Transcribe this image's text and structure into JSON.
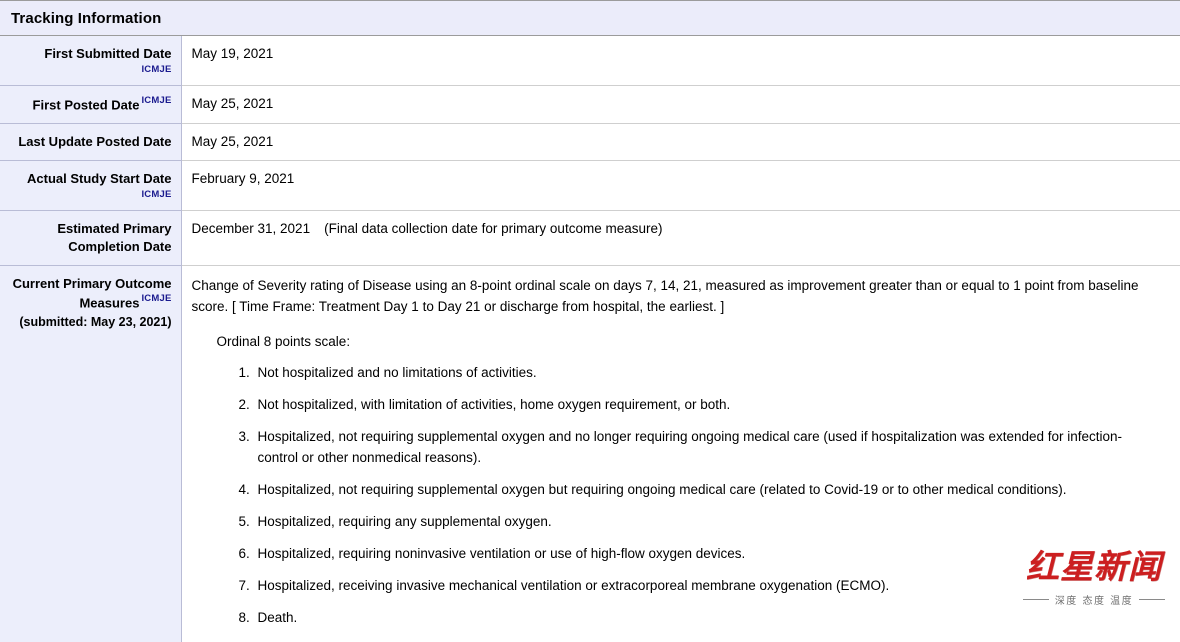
{
  "section": {
    "title": "Tracking Information"
  },
  "icmje_label": "ICMJE",
  "rows": [
    {
      "label": "First Submitted Date",
      "icmje": true,
      "icmje_placement": "below",
      "value": "May 19, 2021"
    },
    {
      "label": "First Posted Date",
      "icmje": true,
      "icmje_placement": "inline",
      "value": "May 25, 2021"
    },
    {
      "label": "Last Update Posted Date",
      "icmje": false,
      "icmje_placement": "none",
      "value": "May 25, 2021"
    },
    {
      "label": "Actual Study Start Date",
      "icmje": true,
      "icmje_placement": "below",
      "value": "February 9, 2021"
    },
    {
      "label": "Estimated Primary Completion Date",
      "icmje": false,
      "icmje_placement": "none",
      "value": "December 31, 2021",
      "value_note": "(Final data collection date for primary outcome measure)"
    }
  ],
  "outcome": {
    "label": "Current Primary Outcome Measures",
    "icmje": true,
    "submitted_note": "(submitted: May 23, 2021)",
    "intro": "Change of Severity rating of Disease using an 8-point ordinal scale on days 7, 14, 21, measured as improvement greater than or equal to 1 point from baseline score. [ Time Frame: Treatment Day 1 to Day 21 or discharge from hospital, the earliest. ]",
    "scale_heading": "Ordinal 8 points scale:",
    "scale_items": [
      "Not hospitalized and no limitations of activities.",
      "Not hospitalized, with limitation of activities, home oxygen requirement, or both.",
      "Hospitalized, not requiring supplemental oxygen and no longer requiring ongoing medical care (used if hospitalization was extended for infection-control or other nonmedical reasons).",
      "Hospitalized, not requiring supplemental oxygen but requiring ongoing medical care (related to Covid-19 or to other medical conditions).",
      "Hospitalized, requiring any supplemental oxygen.",
      "Hospitalized, requiring noninvasive ventilation or use of high-flow oxygen devices.",
      "Hospitalized, receiving invasive mechanical ventilation or extracorporeal membrane oxygenation (ECMO).",
      "Death."
    ]
  },
  "watermark": {
    "brand": "红星新闻",
    "tagline": "深度 态度 温度"
  },
  "colors": {
    "header_bg": "#ebecfa",
    "label_bg": "#eceefb",
    "link": "#1b1b8f",
    "watermark_red": "#cc1f20"
  }
}
